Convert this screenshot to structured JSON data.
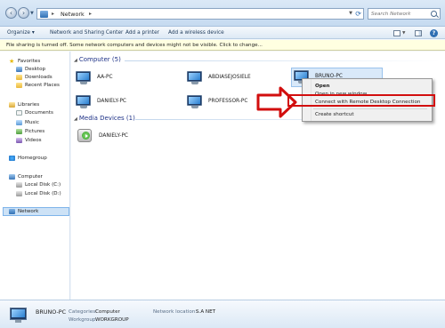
{
  "address": {
    "crumb": "Network",
    "search_placeholder": "Search Network"
  },
  "toolbar": {
    "organize": "Organize ▾",
    "network_sharing_center": "Network and Sharing Center",
    "add_printer": "Add a printer",
    "add_wireless": "Add a wireless device"
  },
  "infobar": {
    "message": "File sharing is turned off. Some network computers and devices might not be visible. Click to change..."
  },
  "sidebar": {
    "favorites": "Favorites",
    "desktop": "Desktop",
    "downloads": "Downloads",
    "recent": "Recent Places",
    "libraries": "Libraries",
    "documents": "Documents",
    "music": "Music",
    "pictures": "Pictures",
    "videos": "Videos",
    "homegroup": "Homegroup",
    "computer": "Computer",
    "disk_c": "Local Disk (C:)",
    "disk_d": "Local Disk (D:)",
    "network": "Network"
  },
  "groups": {
    "computer_header": "Computer (5)",
    "media_header": "Media Devices (1)"
  },
  "computers": [
    "AA-PC",
    "ABDIASEJOSIELE",
    "BRUNO-PC",
    "DANIELY-PC",
    "PROFESSOR-PC"
  ],
  "media_devices": [
    "DANIELY-PC"
  ],
  "context_menu": {
    "open": "Open",
    "open_new_window": "Open in new window",
    "connect_rdc": "Connect with Remote Desktop Connection",
    "create_shortcut": "Create shortcut"
  },
  "details": {
    "name": "BRUNO-PC",
    "categories_label": "Categories:",
    "categories_value": "Computer",
    "workgroup_label": "Workgroup:",
    "workgroup_value": "WORKGROUP",
    "network_location_label": "Network location:",
    "network_location_value": "S.A NET"
  },
  "colors": {
    "highlight_box": "#d20e0e",
    "group_header": "#1e3287",
    "info_bar": "#ffffe1"
  }
}
